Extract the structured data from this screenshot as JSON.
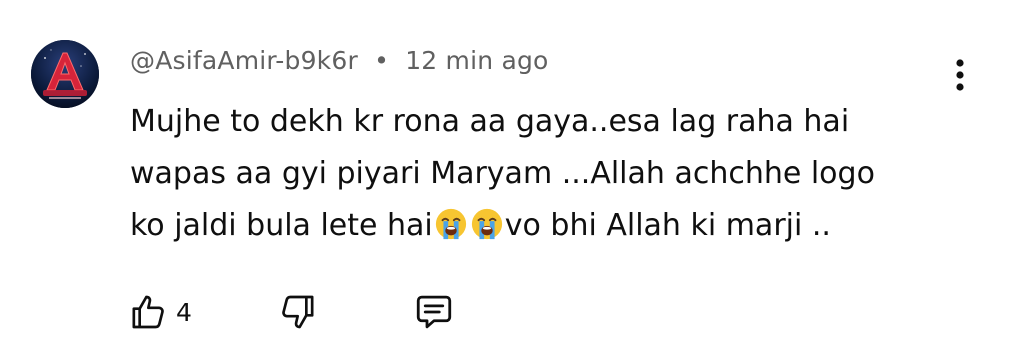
{
  "comment": {
    "author": "@AsifaAmir-b9k6r",
    "separator": "•",
    "timestamp": "12 min ago",
    "text_lines": [
      "Mujhe to dekh kr rona aa gaya..esa lag raha hai",
      "wapas aa gyi piyari Maryam ...Allah achchhe logo",
      "ko jaldi bula lete hai",
      "vo bhi Allah ki marji .."
    ],
    "emoji": "loudly-crying-face",
    "like_count": "4"
  },
  "icons": {
    "more": "more-vert-icon",
    "like": "thumb-up-icon",
    "dislike": "thumb-down-icon",
    "reply": "comment-reply-icon"
  },
  "colors": {
    "meta_text": "#606060",
    "body_text": "#0f0f0f",
    "avatar_bg": "#0b1a3a",
    "avatar_accent": "#d6243a",
    "emoji_face": "#f7c531",
    "emoji_tears": "#4aa3e8"
  }
}
